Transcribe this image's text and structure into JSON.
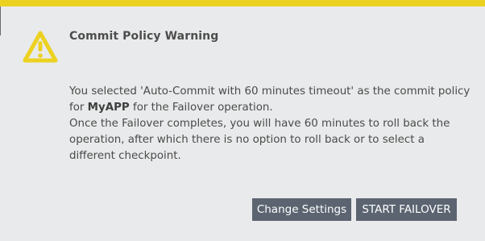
{
  "dialog": {
    "title": "Commit Policy Warning",
    "icon": "warning-triangle-icon",
    "accent_color": "#ecd121",
    "message": {
      "prefix": "You selected 'Auto-Commit with 60 minutes timeout' as the commit policy for ",
      "app_name": "MyAPP",
      "suffix": " for the Failover operation.",
      "line2": "Once the Failover completes, you will have 60 minutes to roll back the operation, after which there is no option to roll back or to select a different checkpoint."
    },
    "buttons": {
      "change_settings": "Change Settings",
      "start_failover": "START FAILOVER"
    }
  }
}
